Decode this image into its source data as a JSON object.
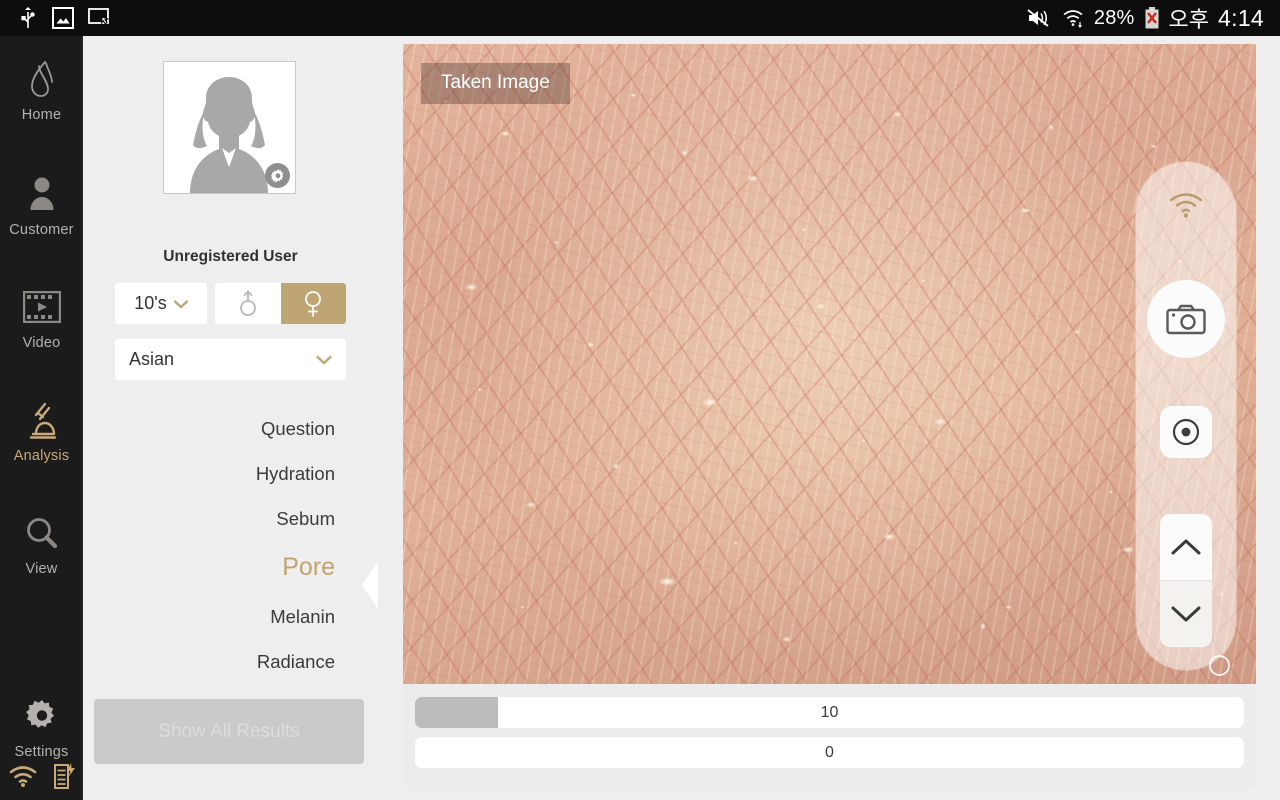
{
  "statusbar": {
    "left_icons": [
      "usb-icon",
      "screenshot-icon",
      "cast-icon"
    ],
    "mute_icon": "volume-mute-icon",
    "wifi_icon": "wifi-icon",
    "battery_percent": "28%",
    "battery_icon": "battery-error-icon",
    "am_pm": "오후",
    "clock": "4:14"
  },
  "rail": {
    "items": [
      {
        "label": "Home",
        "icon": "brand-logo-icon",
        "active": false
      },
      {
        "label": "Customer",
        "icon": "person-icon",
        "active": false
      },
      {
        "label": "Video",
        "icon": "film-strip-icon",
        "active": false
      },
      {
        "label": "Analysis",
        "icon": "microscope-icon",
        "active": true
      },
      {
        "label": "View",
        "icon": "magnifier-icon",
        "active": false
      },
      {
        "label": "Settings",
        "icon": "gear-icon",
        "active": false
      }
    ],
    "bottom_icons": [
      "wifi-status-icon",
      "device-battery-charging-icon"
    ]
  },
  "panel": {
    "avatar": "default-user-avatar",
    "avatar_settings_icon": "gear-icon",
    "username": "Unregistered User",
    "age": {
      "value": "10's",
      "chevron": "chevron-down-icon"
    },
    "gender": {
      "male_icon": "male-symbol-icon",
      "female_icon": "female-symbol-icon",
      "selected": "female"
    },
    "ethnicity": {
      "value": "Asian",
      "chevron": "chevron-down-icon"
    },
    "menu": [
      {
        "label": "Question",
        "active": false
      },
      {
        "label": "Hydration",
        "active": false
      },
      {
        "label": "Sebum",
        "active": false
      },
      {
        "label": "Pore",
        "active": true
      },
      {
        "label": "Melanin",
        "active": false
      },
      {
        "label": "Radiance",
        "active": false
      }
    ],
    "show_all_results": "Show All Results"
  },
  "viewer": {
    "overlay_label": "Taken Image",
    "dock": {
      "wifi_icon": "wifi-icon",
      "shutter_icon": "camera-icon",
      "focus_icon": "focus-target-icon",
      "up_icon": "chevron-up-icon",
      "down_icon": "chevron-down-icon",
      "resize_handle": "resize-handle-icon"
    }
  },
  "metrics": [
    {
      "name": "pore-count-bar",
      "value": "10",
      "fill_percent": 10
    },
    {
      "name": "pore-secondary-bar",
      "value": "0",
      "fill_percent": 0
    }
  ],
  "colors": {
    "accent": "#c0a574",
    "rail_bg": "#1b1b1b",
    "panel_bg": "#eeeeee",
    "statusbar_bg": "#0d0d0d"
  }
}
